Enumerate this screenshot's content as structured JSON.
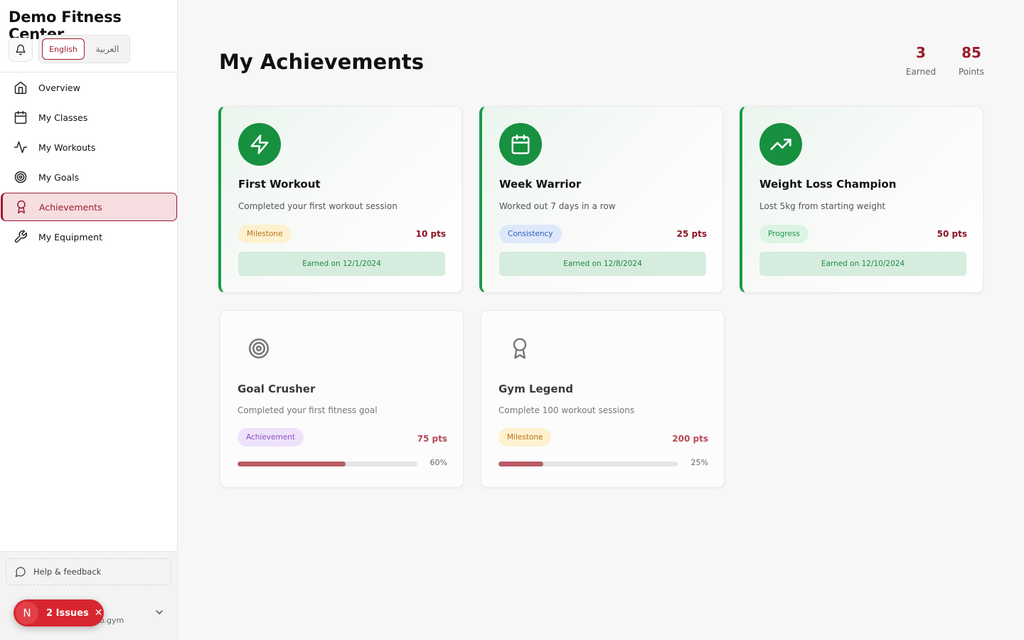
{
  "app": {
    "brand": "Demo Fitness Center",
    "languages": {
      "english": "English",
      "arabic": "العربية"
    }
  },
  "sidebar": {
    "items": [
      {
        "label": "Overview",
        "icon": "home-icon"
      },
      {
        "label": "My Classes",
        "icon": "calendar-icon"
      },
      {
        "label": "My Workouts",
        "icon": "activity-icon"
      },
      {
        "label": "My Goals",
        "icon": "target-icon"
      },
      {
        "label": "Achievements",
        "icon": "award-icon",
        "active": true
      },
      {
        "label": "My Equipment",
        "icon": "wrench-icon"
      }
    ],
    "help_label": "Help & feedback",
    "user_domain": "o.gym"
  },
  "issues_badge": {
    "initial": "N",
    "label": "2 Issues",
    "close": "✕"
  },
  "main": {
    "title": "My Achievements",
    "stats": [
      {
        "value": "3",
        "label": "Earned"
      },
      {
        "value": "85",
        "label": "Points"
      }
    ]
  },
  "achievements": [
    {
      "title": "First Workout",
      "description": "Completed your first workout session",
      "category": "Milestone",
      "points": "10 pts",
      "earned_text": "Earned on 12/1/2024",
      "icon": "zap-icon",
      "status": "earned"
    },
    {
      "title": "Week Warrior",
      "description": "Worked out 7 days in a row",
      "category": "Consistency",
      "points": "25 pts",
      "earned_text": "Earned on 12/8/2024",
      "icon": "calendar-icon",
      "status": "earned"
    },
    {
      "title": "Weight Loss Champion",
      "description": "Lost 5kg from starting weight",
      "category": "Progress",
      "points": "50 pts",
      "earned_text": "Earned on 12/10/2024",
      "icon": "trending-up-icon",
      "status": "earned"
    },
    {
      "title": "Goal Crusher",
      "description": "Completed your first fitness goal",
      "category": "Achievement",
      "points": "75 pts",
      "progress": 60,
      "progress_text": "60%",
      "icon": "target-icon",
      "status": "locked"
    },
    {
      "title": "Gym Legend",
      "description": "Complete 100 workout sessions",
      "category": "Milestone",
      "points": "200 pts",
      "progress": 25,
      "progress_text": "25%",
      "icon": "award-icon",
      "status": "locked"
    }
  ],
  "tag_colors": {
    "Milestone": {
      "bg": "#fdf1cf",
      "fg": "#b7741c"
    },
    "Consistency": {
      "bg": "#dde8fb",
      "fg": "#2e5db8"
    },
    "Progress": {
      "bg": "#dcf4e3",
      "fg": "#23924a"
    },
    "Achievement": {
      "bg": "#efe3fb",
      "fg": "#8a4fc4"
    }
  },
  "colors": {
    "brand": "#9b1b2c",
    "earned_green": "#17903f",
    "progress_fill": "#b85a65"
  }
}
